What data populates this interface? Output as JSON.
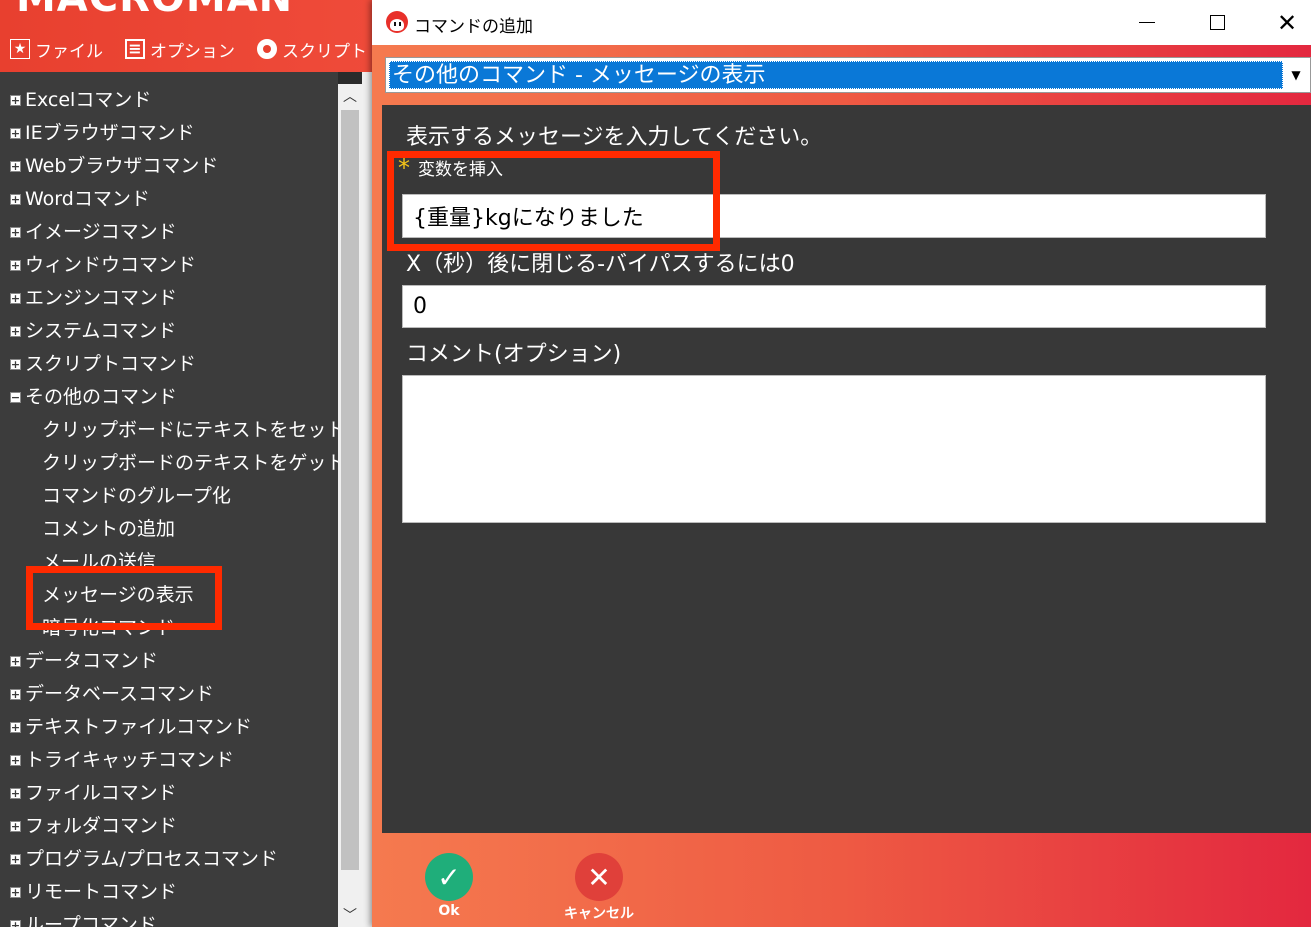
{
  "app": {
    "title": "MACROMAN",
    "menu": [
      {
        "label": "ファイル",
        "icon": "star-icon"
      },
      {
        "label": "オプション",
        "icon": "list-icon"
      },
      {
        "label": "スクリプト",
        "icon": "record-icon"
      }
    ]
  },
  "sidebar": {
    "items": [
      {
        "label": "Excelコマンド",
        "type": "category",
        "expanded": false
      },
      {
        "label": "IEブラウザコマンド",
        "type": "category",
        "expanded": false
      },
      {
        "label": "Webブラウザコマンド",
        "type": "category",
        "expanded": false
      },
      {
        "label": "Wordコマンド",
        "type": "category",
        "expanded": false
      },
      {
        "label": "イメージコマンド",
        "type": "category",
        "expanded": false
      },
      {
        "label": "ウィンドウコマンド",
        "type": "category",
        "expanded": false
      },
      {
        "label": "エンジンコマンド",
        "type": "category",
        "expanded": false
      },
      {
        "label": "システムコマンド",
        "type": "category",
        "expanded": false
      },
      {
        "label": "スクリプトコマンド",
        "type": "category",
        "expanded": false
      },
      {
        "label": "その他のコマンド",
        "type": "category",
        "expanded": true
      },
      {
        "label": "クリップボードにテキストをセット",
        "type": "child"
      },
      {
        "label": "クリップボードのテキストをゲット",
        "type": "child"
      },
      {
        "label": "コマンドのグループ化",
        "type": "child"
      },
      {
        "label": "コメントの追加",
        "type": "child"
      },
      {
        "label": "メールの送信",
        "type": "child"
      },
      {
        "label": "メッセージの表示",
        "type": "child"
      },
      {
        "label": "暗号化コマンド",
        "type": "child"
      },
      {
        "label": "データコマンド",
        "type": "category",
        "expanded": false
      },
      {
        "label": "データベースコマンド",
        "type": "category",
        "expanded": false
      },
      {
        "label": "テキストファイルコマンド",
        "type": "category",
        "expanded": false
      },
      {
        "label": "トライキャッチコマンド",
        "type": "category",
        "expanded": false
      },
      {
        "label": "ファイルコマンド",
        "type": "category",
        "expanded": false
      },
      {
        "label": "フォルダコマンド",
        "type": "category",
        "expanded": false
      },
      {
        "label": "プログラム/プロセスコマンド",
        "type": "category",
        "expanded": false
      },
      {
        "label": "リモートコマンド",
        "type": "category",
        "expanded": false
      },
      {
        "label": "ループコマンド",
        "type": "category",
        "expanded": false
      }
    ]
  },
  "dialog": {
    "title": "コマンドの追加",
    "command_select": "その他のコマンド - メッセージの表示",
    "message_label": "表示するメッセージを入力してください。",
    "insert_variable": "変数を挿入",
    "message_value": "{重量}kgになりました",
    "timeout_label": "X（秒）後に閉じる-バイパスするには0",
    "timeout_value": "0",
    "comment_label": "コメント(オプション)",
    "comment_value": "",
    "ok_label": "Ok",
    "cancel_label": "キャンセル"
  },
  "colors": {
    "accent_red": "#e8402f",
    "highlight_box": "#ff2a00",
    "selection_blue": "#0a78d7",
    "ok_green": "#1fae7a"
  }
}
